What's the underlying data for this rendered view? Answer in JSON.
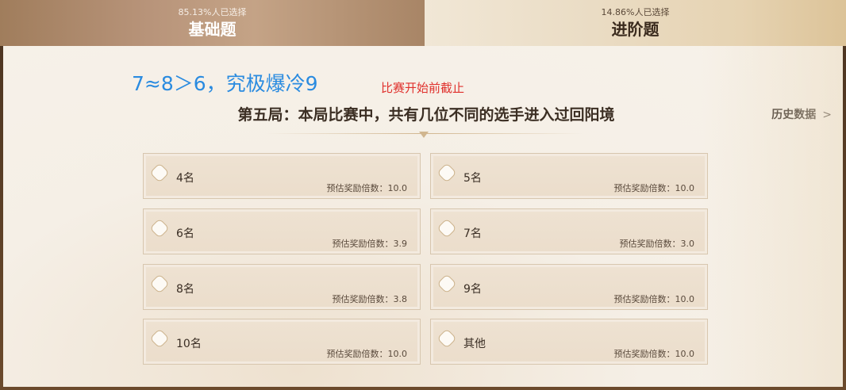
{
  "tabs": [
    {
      "percent": "85.13%人已选择",
      "name": "基础题",
      "active": true
    },
    {
      "percent": "14.86%人已选择",
      "name": "进阶题",
      "active": false
    }
  ],
  "overlay_note": "7≈8＞6，究极爆冷9",
  "deadline": "比赛开始前截止",
  "question": "第五局：本局比赛中，共有几位不同的选手进入过回阳境",
  "history_link": {
    "label": "历史数据",
    "chevron": ">"
  },
  "odds_prefix": "预估奖励倍数：",
  "options": [
    {
      "label": "4名",
      "odds": "预估奖励倍数：10.0"
    },
    {
      "label": "5名",
      "odds": "预估奖励倍数：10.0"
    },
    {
      "label": "6名",
      "odds": "预估奖励倍数：3.9"
    },
    {
      "label": "7名",
      "odds": "预估奖励倍数：3.0"
    },
    {
      "label": "8名",
      "odds": "预估奖励倍数：3.8"
    },
    {
      "label": "9名",
      "odds": "预估奖励倍数：10.0"
    },
    {
      "label": "10名",
      "odds": "预估奖励倍数：10.0"
    },
    {
      "label": "其他",
      "odds": "预估奖励倍数：10.0"
    }
  ],
  "colors": {
    "note_blue": "#2a8be0",
    "deadline_red": "#e0302c",
    "question_text": "#3c2f24"
  }
}
